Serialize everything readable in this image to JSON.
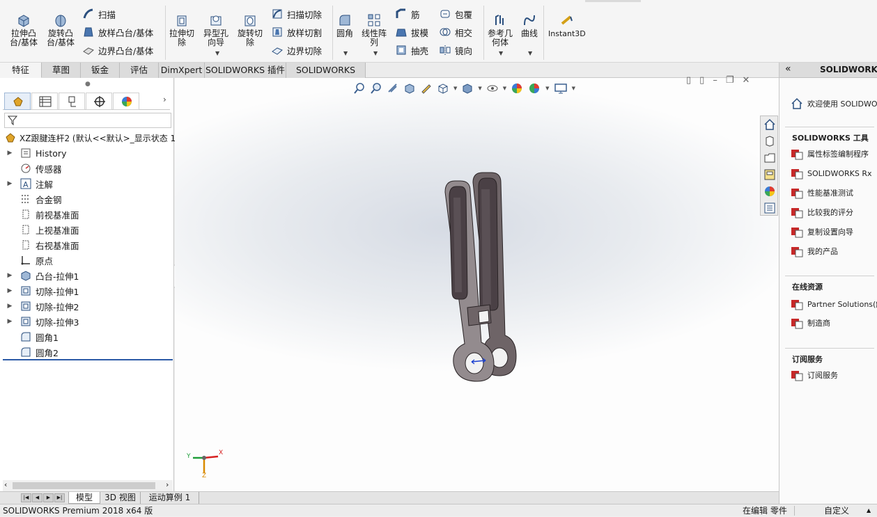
{
  "ribbon": {
    "extrude_boss": "拉伸凸\n台/基体",
    "revolve_boss": "旋转凸\n台/基体",
    "sweep": "扫描",
    "loft_boss": "放样凸台/基体",
    "boundary_boss": "边界凸台/基体",
    "extrude_cut": "拉伸切\n除",
    "hole_wizard": "异型孔\n向导",
    "revolve_cut": "旋转切\n除",
    "sweep_cut": "扫描切除",
    "loft_cut": "放样切割",
    "boundary_cut": "边界切除",
    "fillet": "圆角",
    "linear_pattern": "线性阵\n列",
    "rib": "筋",
    "draft": "拔模",
    "shell": "抽壳",
    "wrap": "包覆",
    "intersect": "相交",
    "mirror": "镜向",
    "ref_geometry": "参考几\n何体",
    "curves": "曲线",
    "instant3d": "Instant3D"
  },
  "tabs": [
    "特征",
    "草图",
    "钣金",
    "评估",
    "DimXpert",
    "SOLIDWORKS 插件",
    "SOLIDWORKS MBD"
  ],
  "tree": {
    "root": "XZ跟腱连杆2 (默认<<默认>_显示状态 1",
    "items": [
      {
        "label": "History",
        "expand": true
      },
      {
        "label": "传感器",
        "expand": false
      },
      {
        "label": "注解",
        "expand": true
      },
      {
        "label": "合金钢",
        "expand": false
      },
      {
        "label": "前视基准面",
        "expand": false
      },
      {
        "label": "上视基准面",
        "expand": false
      },
      {
        "label": "右视基准面",
        "expand": false
      },
      {
        "label": "原点",
        "expand": false
      },
      {
        "label": "凸台-拉伸1",
        "expand": true
      },
      {
        "label": "切除-拉伸1",
        "expand": true
      },
      {
        "label": "切除-拉伸2",
        "expand": true
      },
      {
        "label": "切除-拉伸3",
        "expand": true
      },
      {
        "label": "圆角1",
        "expand": false
      },
      {
        "label": "圆角2",
        "expand": false
      }
    ]
  },
  "right_panel": {
    "title": "SOLIDWORKS",
    "welcome": "欢迎使用 SOLIDWO",
    "tools_heading": "SOLIDWORKS 工具",
    "tools": [
      "属性标签编制程序",
      "SOLIDWORKS Rx",
      "性能基准测试",
      "比较我的评分",
      "复制设置向导",
      "我的产品"
    ],
    "online_heading": "在线资源",
    "online": [
      "Partner Solutions(解",
      "制造商"
    ],
    "subscription_heading": "订阅服务",
    "subscription": [
      "订阅服务"
    ]
  },
  "triad": {
    "x": "X",
    "y": "Y",
    "z": "Z"
  },
  "bottom_tabs": [
    "模型",
    "3D 视图",
    "运动算例 1"
  ],
  "status": {
    "product": "SOLIDWORKS Premium 2018 x64 版",
    "mode": "在编辑 零件",
    "custom": "自定义"
  }
}
